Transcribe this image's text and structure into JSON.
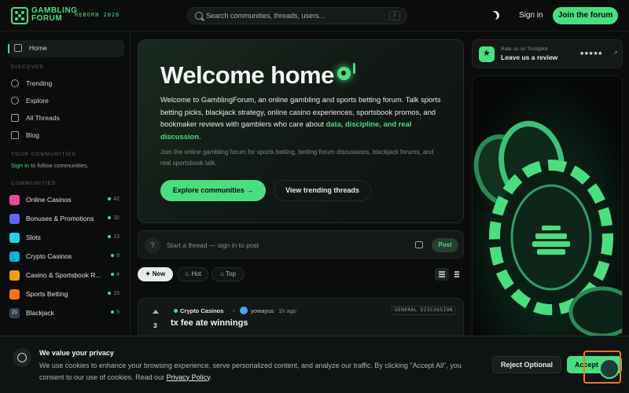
{
  "header": {
    "logo_line1": "GAMBLING",
    "logo_line2": "FORUM",
    "logo_tag": "REBORN 2026",
    "search_placeholder": "Search communities, threads, users...",
    "search_shortcut": "/",
    "signin_label": "Sign in",
    "join_label": "Join the forum"
  },
  "sidebar": {
    "home": "Home",
    "discover_title": "DISCOVER",
    "discover_items": [
      "Trending",
      "Explore",
      "All Threads",
      "Blog"
    ],
    "your_communities_title": "YOUR COMMUNITIES",
    "signin_link": "Sign in",
    "follow_text": " to follow communities.",
    "communities_title": "COMMUNITIES",
    "communities": [
      {
        "name": "Online Casinos",
        "count": "42",
        "color": "#ec4899"
      },
      {
        "name": "Bonuses & Promotions",
        "count": "32",
        "color": "#6366f1"
      },
      {
        "name": "Slots",
        "count": "13",
        "color": "#22d3ee"
      },
      {
        "name": "Crypto Casinos",
        "count": "8",
        "color": "#06b6d4"
      },
      {
        "name": "Casino & Sportsbook R...",
        "count": "4",
        "color": "#f59e0b"
      },
      {
        "name": "Sports Betting",
        "count": "15",
        "color": "#f97316"
      },
      {
        "name": "Blackjack",
        "count": "5",
        "color": "#334155",
        "icon_text": "21"
      }
    ]
  },
  "hero": {
    "title": "Welcome home",
    "p1_a": "Welcome to GamblingForum, an online gambling and sports betting forum. Talk sports betting picks, blackjack strategy, online casino experiences, sportsbook promos, and bookmaker reviews with gamblers who care about ",
    "p1_highlight": "data, discipline, and real discussion",
    "p1_end": ".",
    "p2": "Join the online gambling forum for sports betting, betting forum discussions, blackjack forums, and real sportsbook talk.",
    "explore_btn": "Explore communities →",
    "trending_btn": "View trending threads"
  },
  "compose": {
    "avatar": "?",
    "placeholder": "Start a thread — sign in to post",
    "post_label": "Post"
  },
  "sort_tabs": [
    {
      "label": "New",
      "active": true
    },
    {
      "label": "Hot",
      "active": false
    },
    {
      "label": "Top",
      "active": false
    }
  ],
  "thread": {
    "votes": "3",
    "community": "Crypto Casinos",
    "separator": "•",
    "user": "yowayus",
    "time": "1h ago",
    "tag": "GENERAL DISCUSSION",
    "title": "tx fee ate winnings"
  },
  "trustpilot": {
    "line1": "Rate us on Trustpilot",
    "line2": "Leave us a review",
    "stars": "★★★★★",
    "arrow": "↗"
  },
  "privacy": {
    "title": "We value your privacy",
    "text": "We use cookies to enhance your browsing experience, serve personalized content, and analyze our traffic. By clicking \"Accept All\", you consent to our use of cookies. Read our ",
    "link": "Privacy Policy",
    "text_end": ".",
    "reject": "Reject Optional",
    "accept": "Accept All"
  },
  "colors": {
    "accent": "#4ade80",
    "background": "#0b0d0c"
  }
}
